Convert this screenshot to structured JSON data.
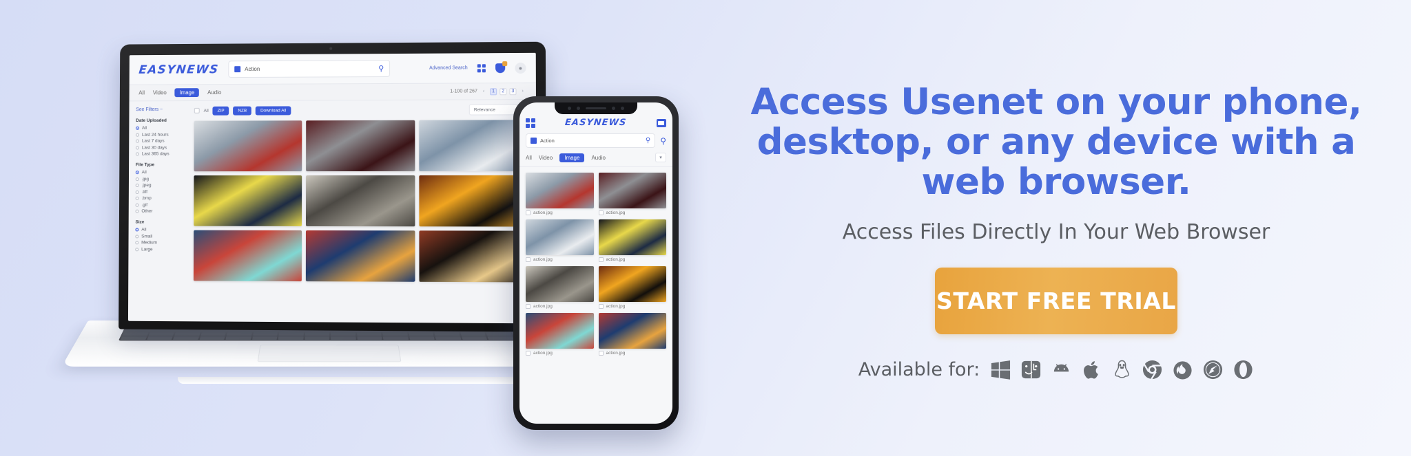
{
  "background": {
    "from": "#d6ddf6",
    "to": "#f4f6fd"
  },
  "brand": {
    "accent": "#4a6cdb",
    "cta": "#e8a33d",
    "logo": "EASYNEWS"
  },
  "promo": {
    "headline": "Access Usenet on your phone, desktop, or any device with a web browser.",
    "subhead": "Access Files Directly In Your Web Browser",
    "cta_label": "START FREE TRIAL",
    "available_label": "Available for:",
    "platforms": [
      {
        "name": "windows-icon",
        "title": "Windows"
      },
      {
        "name": "macos-finder-icon",
        "title": "macOS"
      },
      {
        "name": "android-icon",
        "title": "Android"
      },
      {
        "name": "apple-icon",
        "title": "Apple"
      },
      {
        "name": "linux-tux-icon",
        "title": "Linux"
      },
      {
        "name": "chrome-icon",
        "title": "Chrome"
      },
      {
        "name": "firefox-icon",
        "title": "Firefox"
      },
      {
        "name": "safari-icon",
        "title": "Safari"
      },
      {
        "name": "opera-icon",
        "title": "Opera"
      }
    ]
  },
  "laptop_app": {
    "logo": "EASYNEWS",
    "search": {
      "value": "Action",
      "placeholder": "Search"
    },
    "advanced_search": "Advanced Search",
    "tabs": [
      {
        "label": "All",
        "active": false
      },
      {
        "label": "Video",
        "active": false
      },
      {
        "label": "Image",
        "active": true
      },
      {
        "label": "Audio",
        "active": false
      }
    ],
    "result_count": "1-100 of 267",
    "pages": [
      "1",
      "2",
      "3"
    ],
    "toolbar": {
      "select_all_label": "All",
      "zip_label": "ZIP",
      "nzb_label": "NZB",
      "download_all_label": "Download All",
      "sort_value": "Relevance"
    },
    "filters": {
      "see_filters": "See Filters  −",
      "groups": [
        {
          "title": "Date Uploaded",
          "options": [
            {
              "label": "All",
              "selected": true
            },
            {
              "label": "Last 24 hours",
              "selected": false
            },
            {
              "label": "Last 7 days",
              "selected": false
            },
            {
              "label": "Last 30 days",
              "selected": false
            },
            {
              "label": "Last 365 days",
              "selected": false
            }
          ]
        },
        {
          "title": "File Type",
          "options": [
            {
              "label": "All",
              "selected": true
            },
            {
              "label": ".jpg",
              "selected": false
            },
            {
              "label": ".jpeg",
              "selected": false
            },
            {
              "label": ".tiff",
              "selected": false
            },
            {
              "label": ".bmp",
              "selected": false
            },
            {
              "label": ".gif",
              "selected": false
            },
            {
              "label": "Other",
              "selected": false
            }
          ]
        },
        {
          "title": "Size",
          "options": [
            {
              "label": "All",
              "selected": true
            },
            {
              "label": "Small",
              "selected": false
            },
            {
              "label": "Medium",
              "selected": false
            },
            {
              "label": "Large",
              "selected": false
            }
          ]
        }
      ]
    },
    "results": [
      {
        "alt": "red police car lights",
        "c1": "#b5362e",
        "c2": "#8c9aa8",
        "c3": "#d9dde1"
      },
      {
        "alt": "hooded figure with knife",
        "c1": "#3b1417",
        "c2": "#8e8f93",
        "c3": "#5a1f23"
      },
      {
        "alt": "forensic technician",
        "c1": "#e9ecef",
        "c2": "#7e93a8",
        "c3": "#cfd6dd"
      },
      {
        "alt": "crime scene tape at night",
        "c1": "#1d2b44",
        "c2": "#e8d84a",
        "c3": "#14161c"
      },
      {
        "alt": "bombed building ruins",
        "c1": "#9a968c",
        "c2": "#4c4944",
        "c3": "#cbc7bd"
      },
      {
        "alt": "explosion fireball",
        "c1": "#120f0c",
        "c2": "#f0a520",
        "c3": "#6d2c10"
      },
      {
        "alt": "mecha robot illustration",
        "c1": "#7fd8d3",
        "c2": "#c9453a",
        "c3": "#2b4e78"
      },
      {
        "alt": "flying superhero illustration",
        "c1": "#e7a33f",
        "c2": "#1e3c70",
        "c3": "#b53a32"
      },
      {
        "alt": "bat silhouette at sunset",
        "c1": "#e8c98a",
        "c2": "#17120f",
        "c3": "#8f3a24"
      }
    ]
  },
  "phone_app": {
    "logo": "EASYNEWS",
    "search": {
      "value": "Action",
      "placeholder": "Search"
    },
    "tabs": [
      {
        "label": "All",
        "active": false
      },
      {
        "label": "Video",
        "active": false
      },
      {
        "label": "Image",
        "active": true
      },
      {
        "label": "Audio",
        "active": false
      }
    ],
    "results": [
      {
        "filename": "action.jpg",
        "alt": "red police car lights",
        "c1": "#b5362e",
        "c2": "#8c9aa8",
        "c3": "#d9dde1"
      },
      {
        "filename": "action.jpg",
        "alt": "hooded figure with knife",
        "c1": "#3b1417",
        "c2": "#8e8f93",
        "c3": "#5a1f23"
      },
      {
        "filename": "action.jpg",
        "alt": "forensic technician",
        "c1": "#e9ecef",
        "c2": "#7e93a8",
        "c3": "#cfd6dd"
      },
      {
        "filename": "action.jpg",
        "alt": "crime scene tape at night",
        "c1": "#1d2b44",
        "c2": "#e8d84a",
        "c3": "#14161c"
      },
      {
        "filename": "action.jpg",
        "alt": "bombed building ruins",
        "c1": "#9a968c",
        "c2": "#4c4944",
        "c3": "#cbc7bd"
      },
      {
        "filename": "action.jpg",
        "alt": "explosion fireball",
        "c1": "#120f0c",
        "c2": "#f0a520",
        "c3": "#6d2c10"
      },
      {
        "filename": "action.jpg",
        "alt": "mecha robot illustration",
        "c1": "#7fd8d3",
        "c2": "#c9453a",
        "c3": "#2b4e78"
      },
      {
        "filename": "action.jpg",
        "alt": "flying superhero illustration",
        "c1": "#e7a33f",
        "c2": "#1e3c70",
        "c3": "#b53a32"
      }
    ]
  }
}
